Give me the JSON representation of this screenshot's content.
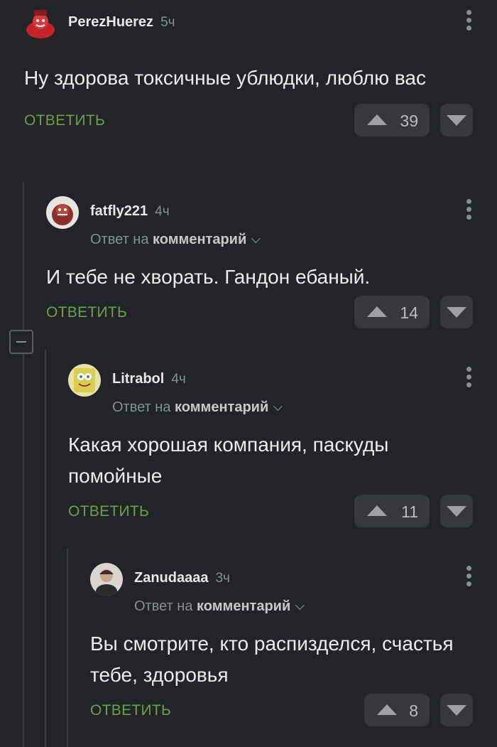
{
  "comments": [
    {
      "user": "PerezHuerez",
      "time": "5ч",
      "reply_prefix": "",
      "reply_target": "",
      "text": "Ну здорова токсичные ублюдки, люблю вас",
      "reply_label": "ОТВЕТИТЬ",
      "votes": "39",
      "avatar": "red-hat-character-avatar"
    },
    {
      "user": "fatfly221",
      "time": "4ч",
      "reply_prefix": "Ответ на",
      "reply_target": "комментарий",
      "text": "И тебе не хворать. Гандон ебаный.",
      "reply_label": "ОТВЕТИТЬ",
      "votes": "14",
      "avatar": "creature-avatar"
    },
    {
      "user": "Litrabol",
      "time": "4ч",
      "reply_prefix": "Ответ на",
      "reply_target": "комментарий",
      "text": "Какая хорошая компания, паскуды помойные",
      "reply_label": "ОТВЕТИТЬ",
      "votes": "11",
      "avatar": "spongebob-avatar"
    },
    {
      "user": "Zanudaaaa",
      "time": "3ч",
      "reply_prefix": "Ответ на",
      "reply_target": "комментарий",
      "text": "Вы смотрите, кто распизделся, счастья тебе, здоровья",
      "reply_label": "ОТВЕТИТЬ",
      "votes": "8",
      "avatar": "man-photo-avatar"
    }
  ],
  "colors": {
    "background": "#222427",
    "reply_green": "#6aa04b",
    "vote_bg": "#35383d"
  }
}
